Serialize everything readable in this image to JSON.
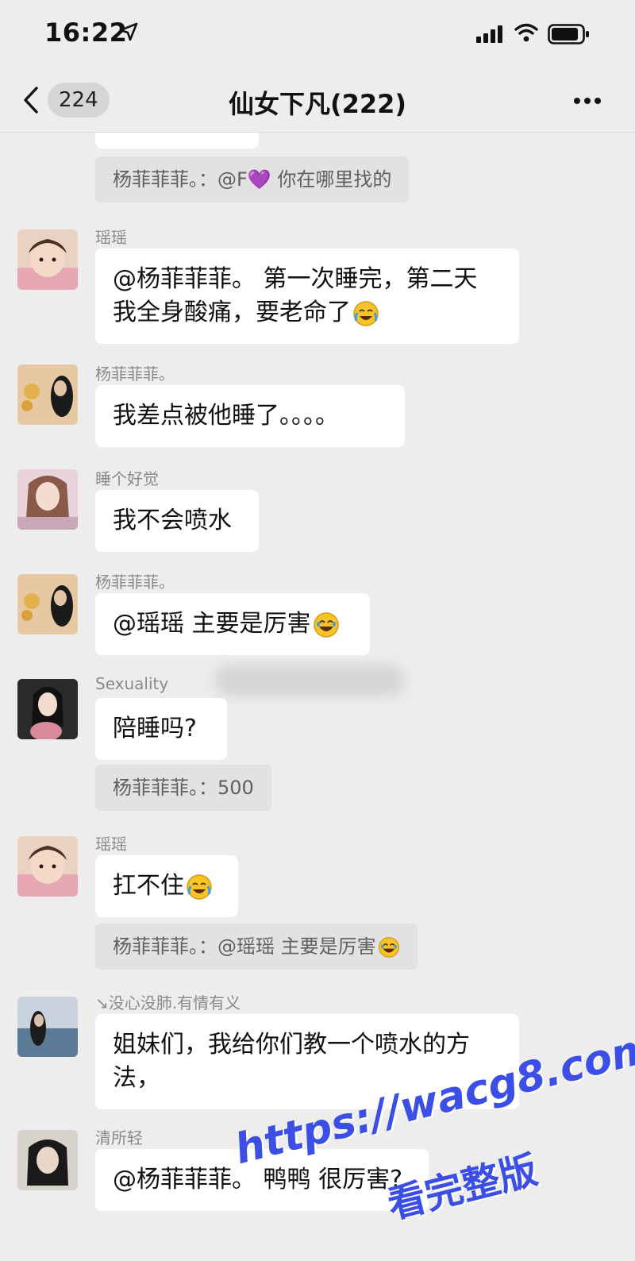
{
  "status_bar": {
    "time": "16:22"
  },
  "nav": {
    "back_count": "224",
    "title": "仙女下凡(222)"
  },
  "messages": [
    {
      "type": "quote",
      "text": "杨菲菲菲。：@F💜 你在哪里找的"
    },
    {
      "type": "message",
      "sender": "瑶瑶",
      "lines": [
        "@杨菲菲菲。 第一次睡完，第二天",
        "我全身酸痛，要老命了"
      ],
      "emoji": "cry-laugh"
    },
    {
      "type": "message",
      "sender": "杨菲菲菲。",
      "text": "我差点被他睡了。。。。"
    },
    {
      "type": "message",
      "sender": "睡个好觉",
      "text": "我不会喷水"
    },
    {
      "type": "message",
      "sender": "杨菲菲菲。",
      "text": "@瑶瑶 主要是厉害",
      "emoji": "laugh"
    },
    {
      "type": "message",
      "sender": "Sexuality",
      "text": "陪睡吗?"
    },
    {
      "type": "quote",
      "text": "杨菲菲菲。：500"
    },
    {
      "type": "message",
      "sender": "瑶瑶",
      "text": "扛不住",
      "emoji": "cry-laugh"
    },
    {
      "type": "quote",
      "text": "杨菲菲菲。：@瑶瑶 主要是厉害",
      "emoji": "laugh"
    },
    {
      "type": "message",
      "sender": "↘没心没肺.有情有义",
      "lines": [
        "姐妹们，我给你们教一个喷水的方",
        "法，"
      ]
    },
    {
      "type": "message",
      "sender": "清所轻",
      "text": "@杨菲菲菲。 鸭鸭 很厉害?"
    }
  ],
  "watermark": {
    "url": "https://wacg8.com",
    "text": "看完整版"
  },
  "colors": {
    "background": "#ededed",
    "bubble": "#ffffff",
    "quote": "#e2e2e2",
    "watermark": "#3b4ee6"
  }
}
